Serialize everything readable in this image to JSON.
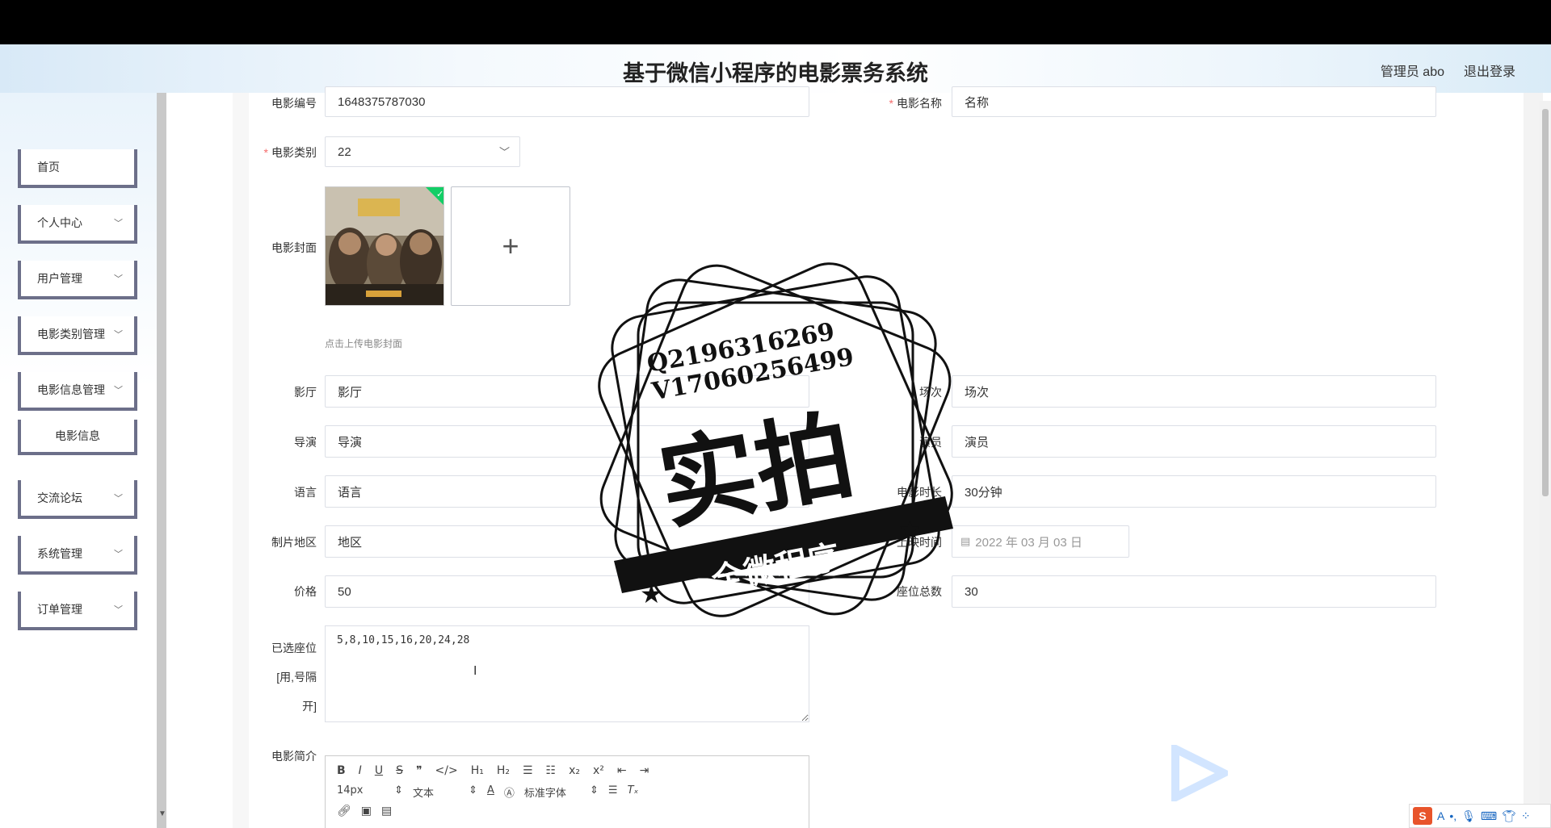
{
  "header": {
    "title": "基于微信小程序的电影票务系统",
    "user": "管理员 abo",
    "logout": "退出登录"
  },
  "sidebar": {
    "items": [
      {
        "label": "首页",
        "has_chevron": false
      },
      {
        "label": "个人中心",
        "has_chevron": true
      },
      {
        "label": "用户管理",
        "has_chevron": true
      },
      {
        "label": "电影类别管理",
        "has_chevron": true
      },
      {
        "label": "电影信息管理",
        "has_chevron": true
      },
      {
        "label": "电影信息",
        "has_chevron": false,
        "sub": true
      },
      {
        "label": "交流论坛",
        "has_chevron": true
      },
      {
        "label": "系统管理",
        "has_chevron": true
      },
      {
        "label": "订单管理",
        "has_chevron": true
      }
    ]
  },
  "form": {
    "movie_no": {
      "label": "电影编号",
      "value": "1648375787030"
    },
    "movie_name": {
      "label": "电影名称",
      "value": "名称"
    },
    "category": {
      "label": "电影类别",
      "value": "22"
    },
    "cover": {
      "label": "电影封面",
      "hint": "点击上传电影封面",
      "add_icon": "+"
    },
    "hall": {
      "label": "影厅",
      "value": "影厅"
    },
    "session": {
      "label": "场次",
      "value": "场次"
    },
    "director": {
      "label": "导演",
      "value": "导演"
    },
    "actor": {
      "label": "演员",
      "value": "演员"
    },
    "language": {
      "label": "语言",
      "value": "语言"
    },
    "duration": {
      "label": "电影时长",
      "value": "30分钟"
    },
    "region": {
      "label": "制片地区",
      "value": "地区"
    },
    "release": {
      "label": "上映时间",
      "value": "2022 年 03 月 03 日"
    },
    "price": {
      "label": "价格",
      "value": "50"
    },
    "total_seats": {
      "label": "座位总数",
      "value": "30"
    },
    "selected_seats": {
      "label_line1": "已选座位",
      "label_line2": "[用,号隔",
      "label_line3": "开]",
      "value": "5,8,10,15,16,20,24,28"
    },
    "intro": {
      "label": "电影简介"
    }
  },
  "editor": {
    "row1": [
      "B",
      "I",
      "U",
      "S",
      "❞",
      "</>",
      "H₁",
      "H₂",
      "☰",
      "☷",
      "x₂",
      "x²",
      "⇤",
      "⇥"
    ],
    "font_size": "14px",
    "block": "文本",
    "font": "标准字体"
  },
  "watermark": {
    "line1": "Q2196316269",
    "line2": "V17060256499",
    "big": "实拍",
    "banner": "全微程序"
  },
  "colors": {
    "accent": "#6c6f89",
    "required": "#f56c6c",
    "ime": "#e8542b"
  }
}
